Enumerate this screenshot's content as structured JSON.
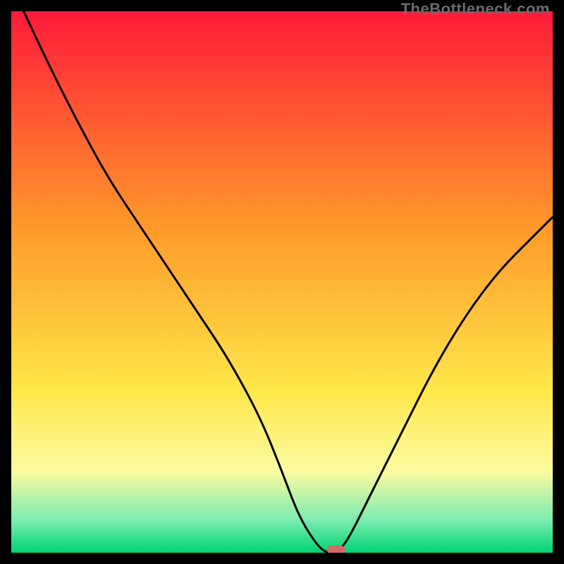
{
  "watermark": "TheBottleneck.com",
  "colors": {
    "frame": "#000000",
    "grad_red": "#ff1a3a",
    "grad_orange": "#ff9a2a",
    "grad_yellow": "#ffe74a",
    "grad_lightyellow": "#fcfba1",
    "grad_mint": "#7aecb0",
    "grad_green": "#00d473",
    "curve": "#000000",
    "marker": "#d46a6a"
  },
  "chart_data": {
    "type": "line",
    "title": "",
    "xlabel": "",
    "ylabel": "",
    "xlim": [
      0,
      100
    ],
    "ylim": [
      0,
      100
    ],
    "x": [
      0,
      6,
      12,
      18,
      24,
      28,
      34,
      40,
      46,
      50,
      53,
      56,
      58,
      60,
      62,
      66,
      72,
      78,
      84,
      90,
      96,
      100
    ],
    "values": [
      105,
      92,
      80,
      69,
      60,
      54,
      45,
      36,
      25,
      15,
      7,
      2,
      0,
      0,
      2,
      10,
      22,
      34,
      44,
      52,
      58,
      62
    ],
    "flat_bottom": {
      "x_start": 56,
      "x_end": 62,
      "y": 0
    },
    "marker": {
      "x": 60,
      "y": 0
    },
    "gradient_stops": [
      {
        "pct": 0,
        "value": 100,
        "label": "red"
      },
      {
        "pct": 40,
        "value": 60,
        "label": "orange"
      },
      {
        "pct": 70,
        "value": 30,
        "label": "yellow"
      },
      {
        "pct": 85,
        "value": 15,
        "label": "light-yellow"
      },
      {
        "pct": 94,
        "value": 6,
        "label": "mint"
      },
      {
        "pct": 100,
        "value": 0,
        "label": "green"
      }
    ]
  }
}
